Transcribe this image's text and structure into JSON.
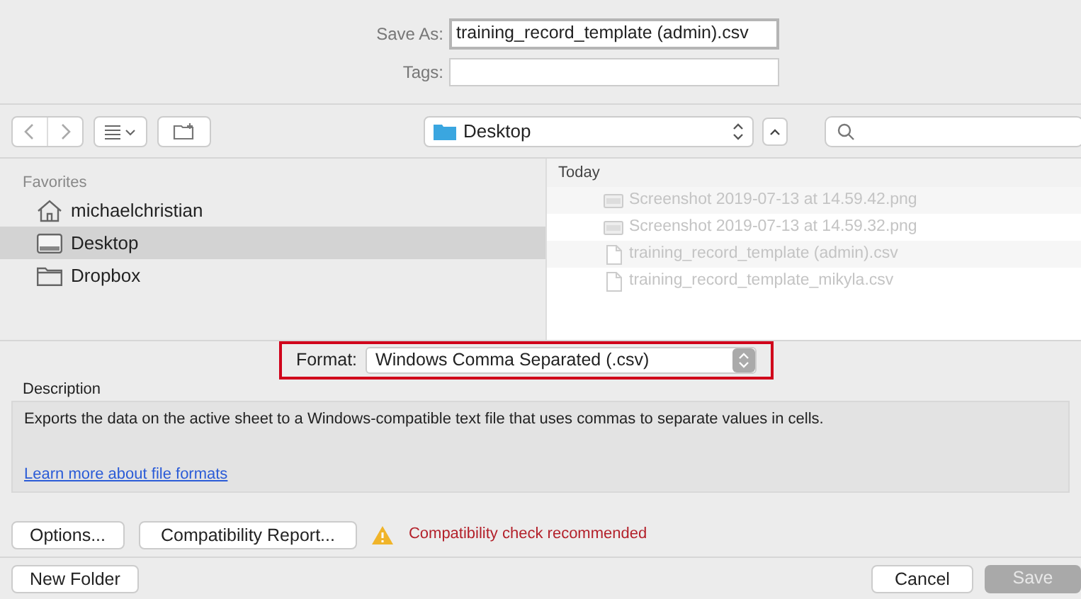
{
  "save_as": {
    "label": "Save As:",
    "value": "training_record_template (admin).csv"
  },
  "tags": {
    "label": "Tags:"
  },
  "toolbar": {
    "location": "Desktop"
  },
  "sidebar": {
    "heading": "Favorites",
    "items": [
      {
        "label": "michaelchristian",
        "kind": "home",
        "selected": false
      },
      {
        "label": "Desktop",
        "kind": "desktop",
        "selected": true
      },
      {
        "label": "Dropbox",
        "kind": "folder",
        "selected": false
      }
    ]
  },
  "files": {
    "heading": "Today",
    "items": [
      {
        "name": "Screenshot 2019-07-13 at 14.59.42.png",
        "kind": "image",
        "disabled": true
      },
      {
        "name": "Screenshot 2019-07-13 at 14.59.32.png",
        "kind": "image",
        "disabled": true
      },
      {
        "name": "training_record_template (admin).csv",
        "kind": "document",
        "disabled": true
      },
      {
        "name": "training_record_template_mikyla.csv",
        "kind": "document",
        "disabled": true
      }
    ]
  },
  "format": {
    "label": "Format:",
    "value": "Windows Comma Separated (.csv)",
    "highlighted": true
  },
  "description": {
    "heading": "Description",
    "text": "Exports the data on the active sheet to a Windows-compatible text file that uses commas to separate values in cells.",
    "link": "Learn more about file formats"
  },
  "options_button": "Options...",
  "report_button": "Compatibility Report...",
  "warning": "Compatibility check recommended",
  "new_folder_button": "New Folder",
  "cancel_button": "Cancel",
  "save_button": {
    "label": "Save",
    "disabled": true
  }
}
